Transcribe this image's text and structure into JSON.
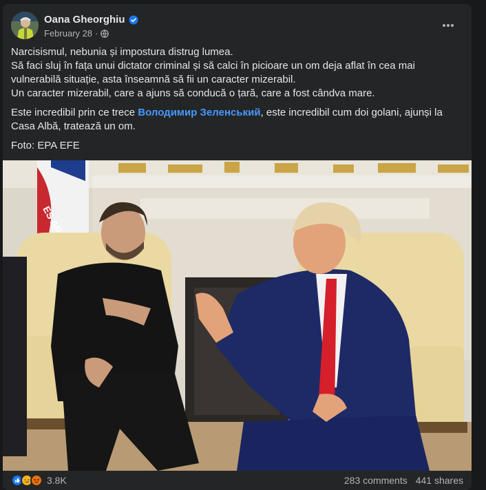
{
  "post": {
    "author": "Oana Gheorghiu",
    "date": "February 28",
    "separator": "·",
    "privacy_icon": "globe-icon",
    "verified_icon": "verified-badge-icon",
    "more_icon": "more-options-icon",
    "paragraph1": {
      "line1": "Narcisismul, nebunia și impostura distrug lumea.",
      "line2": "Să faci sluj în fața unui dictator criminal și să calci în picioare un om deja aflat în cea mai vulnerabilă situație, asta înseamnă să fii un caracter mizerabil.",
      "line3": "Un caracter mizerabil, care a ajuns să conducă o țară, care a fost cândva mare."
    },
    "paragraph2": {
      "before": "Este incredibil prin ce trece ",
      "mention": "Володимир Зеленський",
      "after": ", este incredibil cum doi golani, ajunși la Casa Albă, tratează un om."
    },
    "credit": "Foto: EPA EFE",
    "flag_text": "ES AR"
  },
  "footer": {
    "reaction_icons": [
      "like-icon",
      "sad-icon",
      "angry-icon"
    ],
    "reaction_count": "3.8K",
    "comments": "283 comments",
    "shares": "441 shares"
  },
  "colors": {
    "background": "#18191a",
    "card": "#242526",
    "text": "#e4e6eb",
    "secondary": "#b0b3b8",
    "link": "#4599ff",
    "like": "#1877f2",
    "sad": "#f7b125",
    "angry": "#e9710f"
  }
}
